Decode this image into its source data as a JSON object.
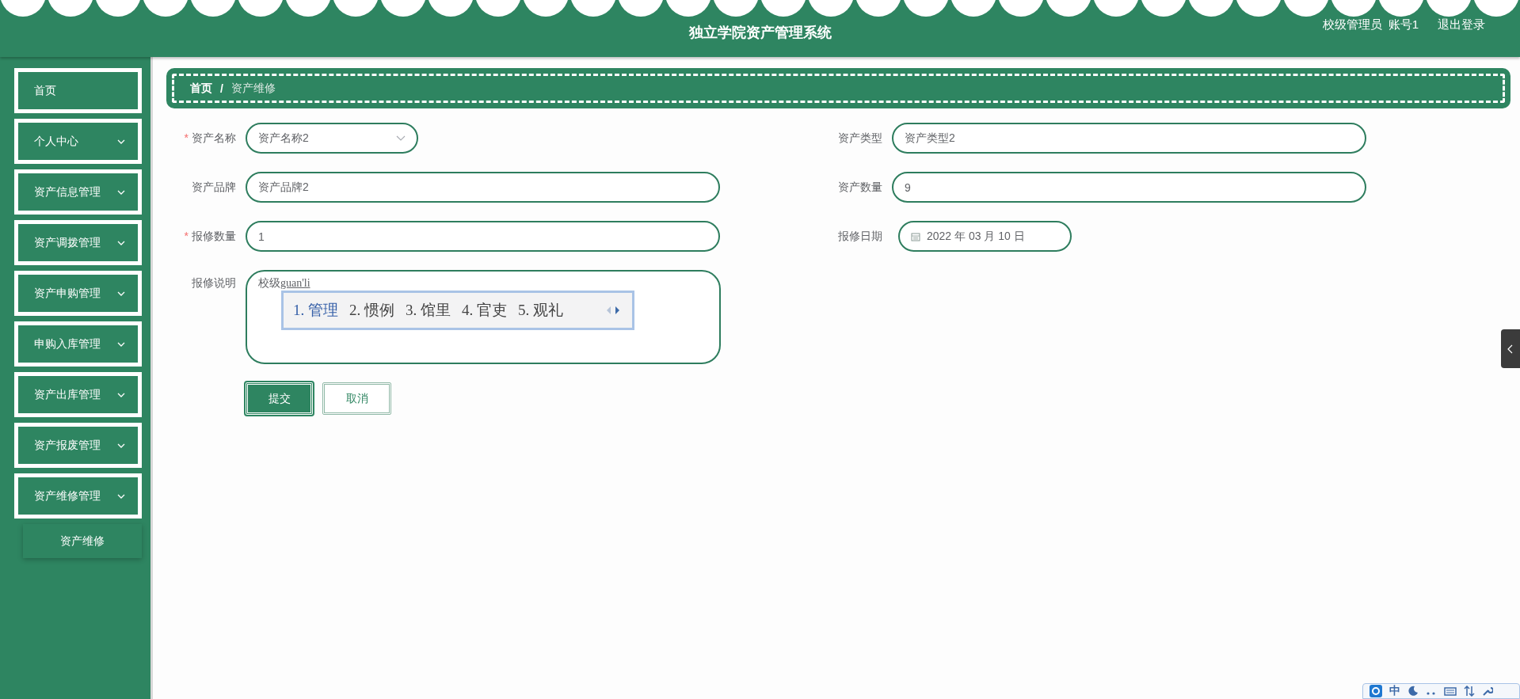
{
  "header": {
    "title": "独立学院资产管理系统",
    "role": "校级管理员",
    "account": "账号1",
    "logout": "退出登录"
  },
  "sidebar": {
    "items": [
      {
        "label": "首页",
        "kind": "link"
      },
      {
        "label": "个人中心",
        "kind": "submenu"
      },
      {
        "label": "资产信息管理",
        "kind": "submenu"
      },
      {
        "label": "资产调拨管理",
        "kind": "submenu"
      },
      {
        "label": "资产申购管理",
        "kind": "submenu"
      },
      {
        "label": "申购入库管理",
        "kind": "submenu"
      },
      {
        "label": "资产出库管理",
        "kind": "submenu"
      },
      {
        "label": "资产报废管理",
        "kind": "submenu"
      },
      {
        "label": "资产维修管理",
        "kind": "submenu",
        "children": [
          {
            "label": "资产维修"
          }
        ]
      }
    ]
  },
  "breadcrumb": {
    "separator": "/",
    "items": [
      "首页",
      "资产维修"
    ]
  },
  "form": {
    "required_mark": "*",
    "left": [
      {
        "label": "资产名称",
        "kind": "select",
        "required": true,
        "value": "资产名称2"
      },
      {
        "label": "资产品牌",
        "kind": "text",
        "required": false,
        "value": "资产品牌2"
      },
      {
        "label": "报修数量",
        "kind": "text",
        "required": true,
        "value": "1"
      },
      {
        "label": "报修说明",
        "kind": "textarea",
        "required": false,
        "value": "校级",
        "composition": "guan'li"
      }
    ],
    "right": [
      {
        "label": "资产类型",
        "kind": "text",
        "required": false,
        "value": "资产类型2"
      },
      {
        "label": "资产数量",
        "kind": "text",
        "required": false,
        "value": "9"
      },
      {
        "label": "报修日期",
        "kind": "date",
        "required": false,
        "value": "2022 年 03 月 10 日"
      }
    ],
    "buttons": [
      {
        "label": "提交",
        "kind": "primary"
      },
      {
        "label": "取消",
        "kind": "secondary"
      }
    ]
  },
  "ime_candidates": [
    {
      "label": "1. 管理",
      "selected": true
    },
    {
      "label": "2. 惯例",
      "selected": false
    },
    {
      "label": "3. 馆里",
      "selected": false
    },
    {
      "label": "4. 官吏",
      "selected": false
    },
    {
      "label": "5. 观礼",
      "selected": false
    }
  ],
  "ime_status": {
    "mode": "中"
  }
}
